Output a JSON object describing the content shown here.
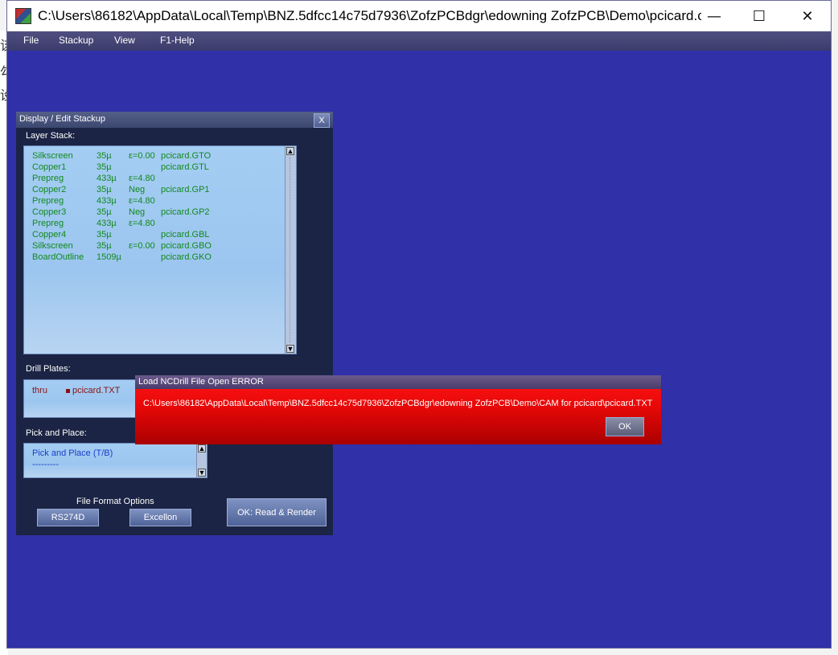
{
  "window": {
    "title": "C:\\Users\\86182\\AppData\\Local\\Temp\\BNZ.5dfcc14c75d7936\\ZofzPCBdgr\\edowning ZofzPCB\\Demo\\pcicard.c...",
    "minimize": "—",
    "maximize": "☐",
    "close": "✕"
  },
  "background_text": [
    "该",
    "勾",
    "设"
  ],
  "menu": {
    "items": [
      "File",
      "Stackup",
      "View",
      "F1-Help"
    ]
  },
  "stackup_dialog": {
    "title": "Display / Edit Stackup",
    "close_label": "X",
    "layer_stack_label": "Layer Stack:",
    "layers": [
      {
        "name": "Silkscreen",
        "thickness": "35µ",
        "param": "ε=0.00",
        "file": "pcicard.GTO"
      },
      {
        "name": "Copper1",
        "thickness": "35µ",
        "param": "",
        "file": "pcicard.GTL"
      },
      {
        "name": "Prepreg",
        "thickness": "433µ",
        "param": "ε=4.80",
        "file": ""
      },
      {
        "name": "Copper2",
        "thickness": "35µ",
        "param": "Neg",
        "file": "pcicard.GP1"
      },
      {
        "name": "Prepreg",
        "thickness": "433µ",
        "param": "ε=4.80",
        "file": ""
      },
      {
        "name": "Copper3",
        "thickness": "35µ",
        "param": "Neg",
        "file": "pcicard.GP2"
      },
      {
        "name": "Prepreg",
        "thickness": "433µ",
        "param": "ε=4.80",
        "file": ""
      },
      {
        "name": "Copper4",
        "thickness": "35µ",
        "param": "",
        "file": "pcicard.GBL"
      },
      {
        "name": "Silkscreen",
        "thickness": "35µ",
        "param": "ε=0.00",
        "file": "pcicard.GBO"
      },
      {
        "name": "BoardOutline",
        "thickness": "1509µ",
        "param": "",
        "file": "pcicard.GKO"
      }
    ],
    "drill_label": "Drill Plates:",
    "drill": {
      "type": "thru",
      "file": "pcicard.TXT",
      "marker_color": "#8b1010"
    },
    "pnp_label": "Pick and Place:",
    "pnp_line1": "Pick and Place (T/B)",
    "pnp_line2": "---------",
    "format_label": "File Format Options",
    "rs274d_button": "RS274D",
    "excellon_button": "Excellon",
    "ok_button": "OK:  Read & Render"
  },
  "error_dialog": {
    "title": "Load NCDrill File Open ERROR",
    "message": "C:\\Users\\86182\\AppData\\Local\\Temp\\BNZ.5dfcc14c75d7936\\ZofzPCBdgr\\edowning ZofzPCB\\Demo\\CAM for pcicard\\pcicard.TXT",
    "ok_button": "OK"
  },
  "colors": {
    "desktop_blue": "#3030a8",
    "layer_text": "#11891d",
    "pnp_text": "#1a3ec8",
    "error_red": "#e80808"
  }
}
